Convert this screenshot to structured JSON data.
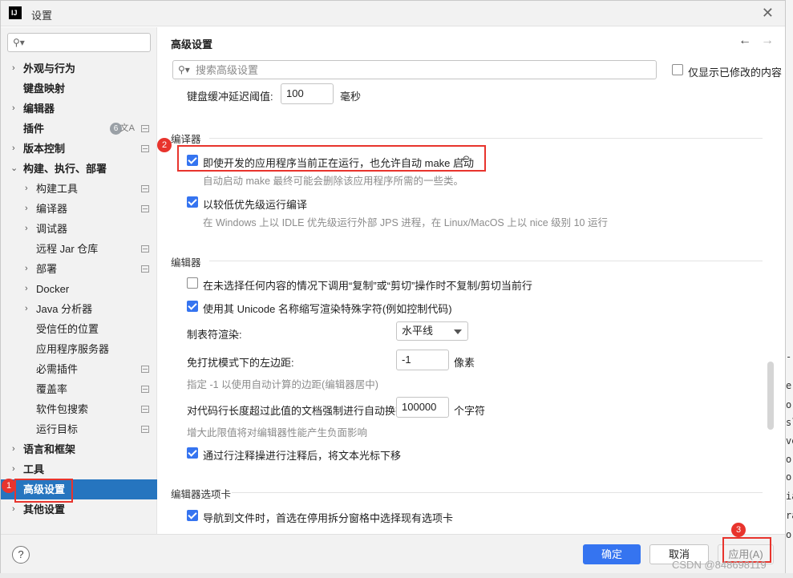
{
  "window": {
    "title": "设置",
    "logo": "IJ"
  },
  "sidebar": {
    "search_placeholder": "",
    "items": [
      {
        "label": "外观与行为",
        "expandable": true
      },
      {
        "label": "键盘映射"
      },
      {
        "label": "编辑器",
        "expandable": true
      },
      {
        "label": "插件",
        "badge": "6",
        "badge2": "文A"
      },
      {
        "label": "版本控制",
        "expandable": true
      },
      {
        "label": "构建、执行、部署",
        "expanded": true
      },
      {
        "label": "构建工具",
        "expandable": true
      },
      {
        "label": "编译器",
        "expandable": true
      },
      {
        "label": "调试器",
        "expandable": true
      },
      {
        "label": "远程 Jar 仓库"
      },
      {
        "label": "部署",
        "expandable": true
      },
      {
        "label": "Docker",
        "expandable": true
      },
      {
        "label": "Java 分析器",
        "expandable": true
      },
      {
        "label": "受信任的位置"
      },
      {
        "label": "应用程序服务器"
      },
      {
        "label": "必需插件"
      },
      {
        "label": "覆盖率"
      },
      {
        "label": "软件包搜索"
      },
      {
        "label": "运行目标"
      },
      {
        "label": "语言和框架",
        "expandable": true
      },
      {
        "label": "工具",
        "expandable": true
      },
      {
        "label": "高级设置",
        "selected": true
      },
      {
        "label": "其他设置",
        "expandable": true
      }
    ]
  },
  "main": {
    "title": "高级设置",
    "back_arrow": "←",
    "forward_arrow": "→",
    "search_placeholder": "搜索高级设置",
    "only_modified_label": "仅显示已修改的内容",
    "keyboard_delay": {
      "label": "键盘缓冲延迟阈值:",
      "value": "100",
      "unit": "毫秒"
    },
    "compiler_section": {
      "heading": "编译器",
      "auto_make": {
        "label": "即使开发的应用程序当前正在运行，也允许自动 make 启动",
        "checked": true,
        "hint": "自动启动 make 最终可能会删除该应用程序所需的一些类。"
      },
      "low_priority": {
        "label": "以较低优先级运行编译",
        "checked": true,
        "hint": "在 Windows 上以 IDLE 优先级运行外部 JPS 进程，在 Linux/MacOS 上以 nice 级别 10 运行"
      }
    },
    "editor_section": {
      "heading": "编辑器",
      "no_copy_cut": {
        "label": "在未选择任何内容的情况下调用“复制”或“剪切”操作时不复制/剪切当前行",
        "checked": false
      },
      "unicode_names": {
        "label": "使用其 Unicode 名称缩写渲染特殊字符(例如控制代码)",
        "checked": true
      },
      "tab_render": {
        "label": "制表符渲染:",
        "value": "水平线"
      },
      "distraction_margin": {
        "label": "免打扰模式下的左边距:",
        "value": "-1",
        "unit": "像素",
        "hint": "指定 -1 以使用自动计算的边距(编辑器居中)"
      },
      "line_length": {
        "label": "对代码行长度超过此值的文档强制进行自动换行:",
        "value": "100000",
        "unit": "个字符",
        "hint": "增大此限值将对编辑器性能产生负面影响"
      },
      "comment_move": {
        "label": "通过行注释操进行注释后，将文本光标下移",
        "checked": true
      }
    },
    "tabs_section": {
      "heading": "编辑器选项卡",
      "navigate_preview": {
        "label": "导航到文件时，首选在停用拆分窗格中选择现有选项卡",
        "checked": true
      }
    }
  },
  "annotations": {
    "marker1": "1",
    "marker2": "2",
    "marker3": "3"
  },
  "buttons": {
    "help": "?",
    "ok": "确定",
    "cancel": "取消",
    "apply": "应用(A)"
  },
  "watermark": "CSDN @848698119",
  "right_fragments": [
    "-",
    "e",
    "or",
    "sl",
    "ve",
    "or",
    "or",
    "ia",
    "ra",
    "or"
  ],
  "colors": {
    "accent": "#3574f0",
    "selection": "#2675bf",
    "annotation": "#e8342d"
  }
}
